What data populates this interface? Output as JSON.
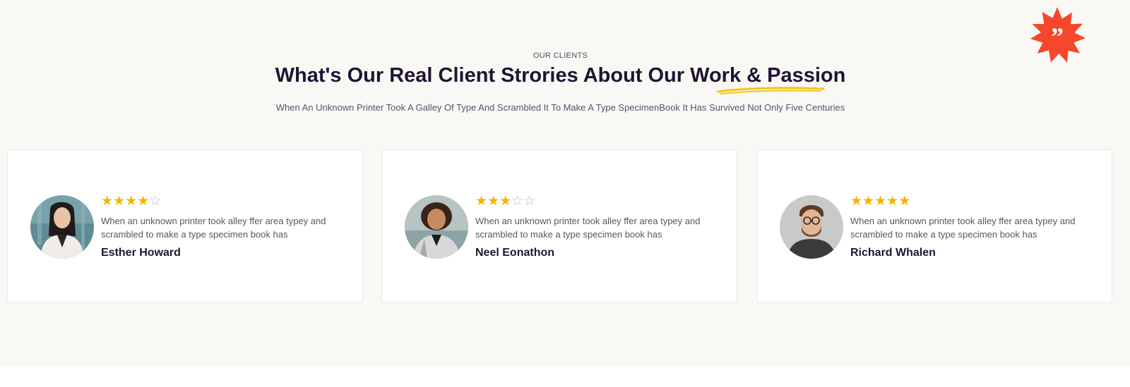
{
  "section": {
    "eyebrow": "OUR CLIENTS",
    "title": "What's Our Real Client Strories About Our Work & Passion",
    "subtitle": "When An Unknown Printer Took A Galley Of Type And Scrambled It To Make A Type SpecimenBook It Has Survived Not Only Five Centuries"
  },
  "badge": {
    "icon": "quote-icon",
    "color": "#f5472b"
  },
  "colors": {
    "heading": "#1e1533",
    "star": "#f4b400",
    "underline": "#f5c518",
    "background": "#f9f8f5"
  },
  "testimonials": [
    {
      "name": "Esther Howard",
      "rating": 4,
      "max_rating": 5,
      "quote": "When an unknown printer took alley ffer area typey and scrambled to make a type specimen book has",
      "avatar": "woman-portrait"
    },
    {
      "name": "Neel Eonathon",
      "rating": 3,
      "max_rating": 5,
      "quote": "When an unknown printer took alley ffer area typey and scrambled to make a type specimen book has",
      "avatar": "woman-portrait-curly"
    },
    {
      "name": "Richard Whalen",
      "rating": 5,
      "max_rating": 5,
      "quote": "When an unknown printer took alley ffer area typey and scrambled to make a type specimen book has",
      "avatar": "man-portrait-glasses"
    }
  ]
}
